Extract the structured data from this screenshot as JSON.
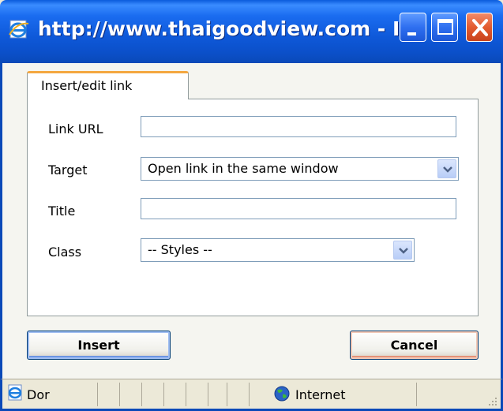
{
  "window": {
    "title": "http://www.thaigoodview.com - I...",
    "app_icon": "ie-page-icon",
    "controls": {
      "minimize": "minimize-icon",
      "maximize": "maximize-icon",
      "close": "close-icon"
    }
  },
  "dialog": {
    "tab_label": "Insert/edit link",
    "fields": {
      "link_url": {
        "label": "Link URL",
        "value": ""
      },
      "target": {
        "label": "Target",
        "selected": "Open link in the same window"
      },
      "title": {
        "label": "Title",
        "value": ""
      },
      "class": {
        "label": "Class",
        "selected": "-- Styles --"
      }
    },
    "buttons": {
      "insert": "Insert",
      "cancel": "Cancel"
    }
  },
  "statusbar": {
    "status_text": "Dor",
    "zone_text": "Internet",
    "zone_icon": "globe-icon",
    "page_icon": "ie-page-icon"
  },
  "colors": {
    "titlebar": "#0e58d8",
    "tab_accent": "#f4a740",
    "close_button": "#e35b2f"
  }
}
